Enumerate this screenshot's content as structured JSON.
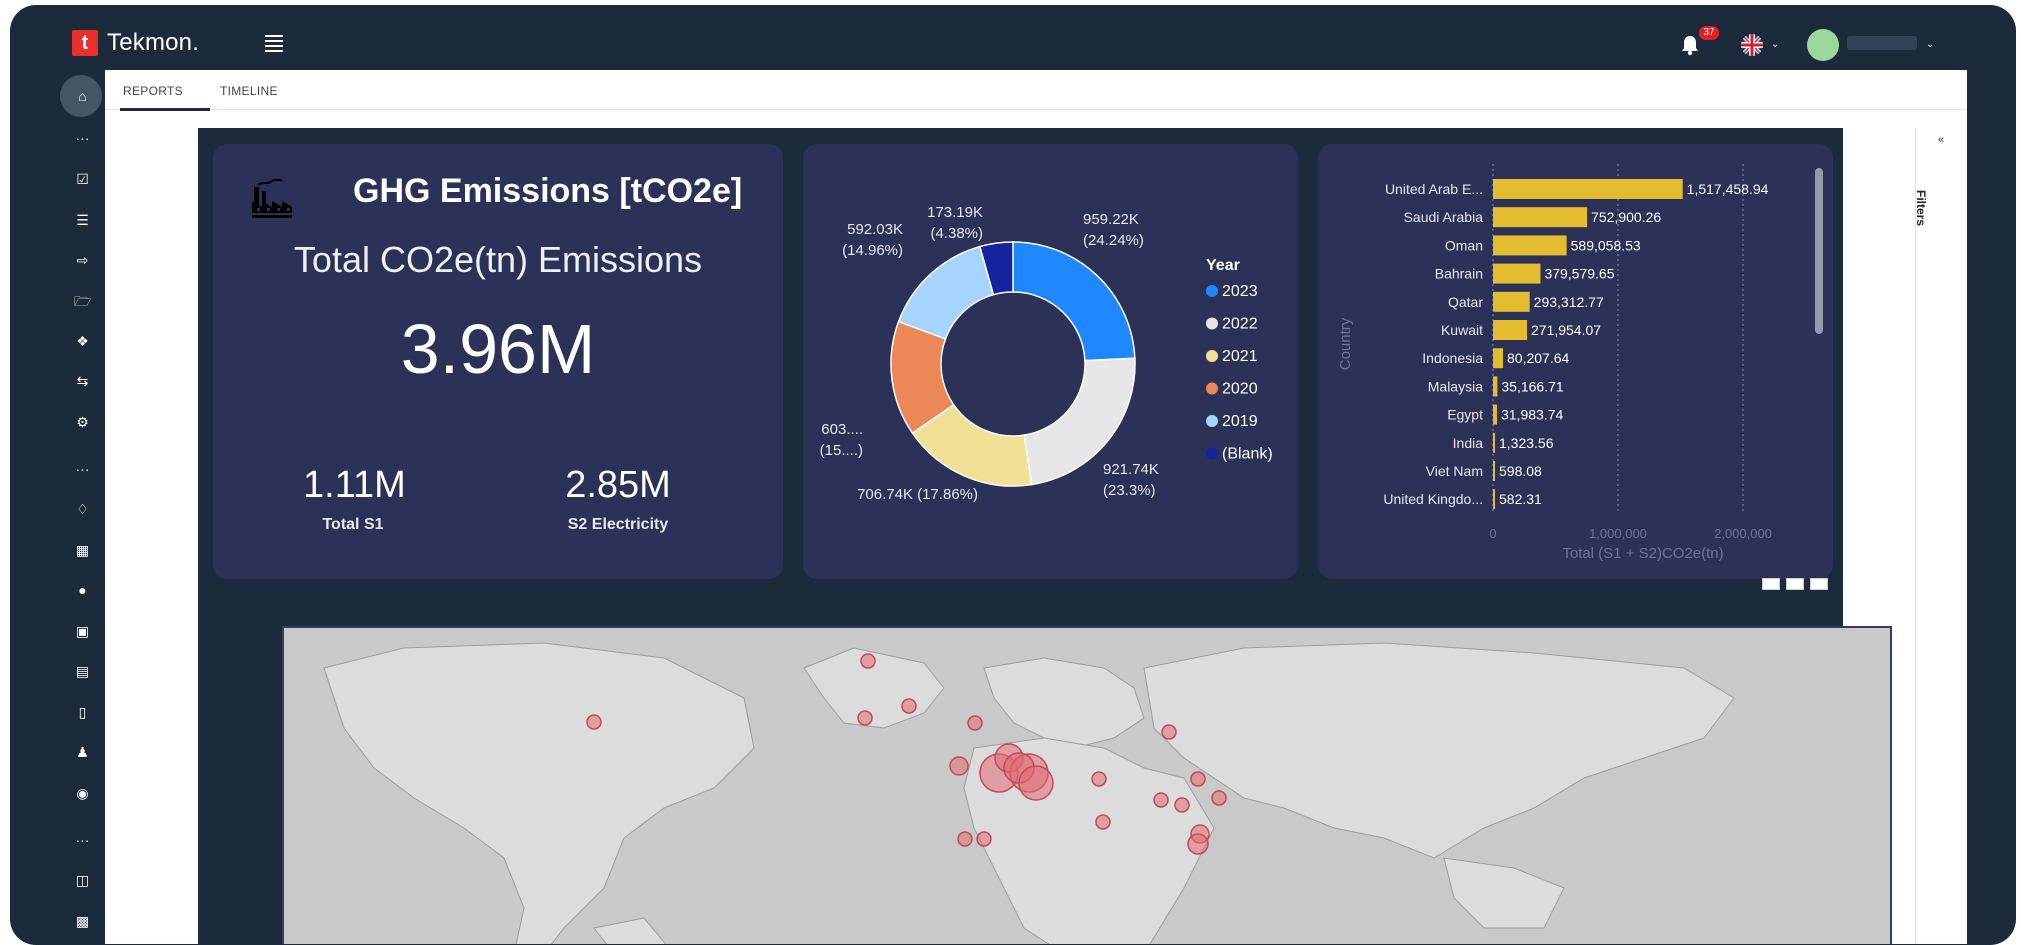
{
  "app": {
    "logo_mark": "t",
    "name": "Tekmon."
  },
  "header": {
    "notification_count": "37",
    "icons": [
      "menu-icon",
      "bell-icon",
      "uk-flag-icon",
      "avatar-icon"
    ]
  },
  "tabs": [
    {
      "label": "REPORTS"
    },
    {
      "label": "TIMELINE"
    }
  ],
  "filters": {
    "label": "Filters"
  },
  "kpi": {
    "title": "GHG Emissions [tCO2e]",
    "subtitle": "Total CO2e(tn) Emissions",
    "total": "3.96M",
    "s1_value": "1.11M",
    "s1_label": "Total S1",
    "s2_value": "2.85M",
    "s2_label": "S2 Electricity"
  },
  "chart_data": [
    {
      "type": "pie",
      "legend_title": "Year",
      "legend_position": "right",
      "slices": [
        {
          "label": "2023",
          "value": 959.22,
          "unit": "K",
          "percent": 24.24,
          "color": "#1f87ff",
          "text": "959.22K",
          "pct_text": "(24.24%)"
        },
        {
          "label": "2022",
          "value": 921.74,
          "unit": "K",
          "percent": 23.3,
          "color": "#e6e6e6",
          "text": "921.74K",
          "pct_text": "(23.3%)"
        },
        {
          "label": "2021",
          "value": 706.74,
          "unit": "K",
          "percent": 17.86,
          "color": "#f0e095",
          "text": "706.74K (17.86%)",
          "pct_text": ""
        },
        {
          "label": "2020",
          "value": 603,
          "unit": "K",
          "percent": 15.2,
          "color": "#ec8857",
          "text": "603....",
          "pct_text": "(15....)"
        },
        {
          "label": "2019",
          "value": 592.03,
          "unit": "K",
          "percent": 14.96,
          "color": "#a7d4ff",
          "text": "592.03K",
          "pct_text": "(14.96%)"
        },
        {
          "label": "(Blank)",
          "value": 173.19,
          "unit": "K",
          "percent": 4.38,
          "color": "#14239e",
          "text": "173.19K",
          "pct_text": "(4.38%)"
        }
      ]
    },
    {
      "type": "bar",
      "orientation": "horizontal",
      "ylabel": "Country",
      "xlabel": "Total (S1 + S2)CO2e(tn)",
      "xlim": [
        0,
        2200000
      ],
      "xticks": [
        "0",
        "1,000,000",
        "2,000,000"
      ],
      "categories": [
        "United Arab E...",
        "Saudi Arabia",
        "Oman",
        "Bahrain",
        "Qatar",
        "Kuwait",
        "Indonesia",
        "Malaysia",
        "Egypt",
        "India",
        "Viet Nam",
        "United Kingdo..."
      ],
      "values": [
        1517458.94,
        752900.26,
        589058.53,
        379579.65,
        293312.77,
        271954.07,
        80207.64,
        35166.71,
        31983.74,
        1323.56,
        598.08,
        582.31
      ],
      "value_labels": [
        "1,517,458.94",
        "752,900.26",
        "589,058.53",
        "379,579.65",
        "293,312.77",
        "271,954.07",
        "80,207.64",
        "35,166.71",
        "31,983.74",
        "1,323.56",
        "598.08",
        "582.31"
      ],
      "color": "#e3bd2f"
    }
  ]
}
